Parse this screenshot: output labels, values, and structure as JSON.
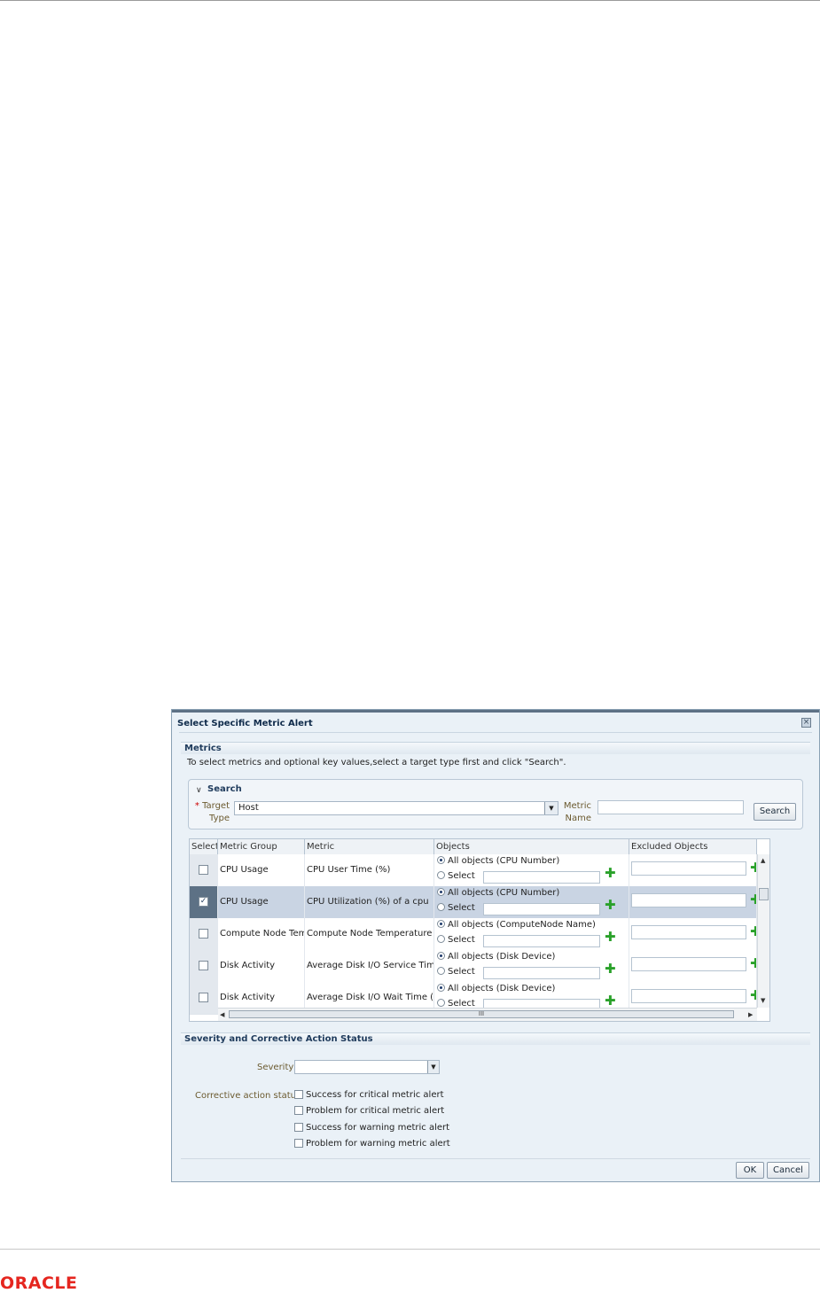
{
  "dialog": {
    "title": "Select Specific Metric Alert",
    "close_glyph": "×",
    "metrics_header": "Metrics",
    "instructions": "To select metrics and optional key values,select a target type first and click \"Search\".",
    "search": {
      "title": "Search",
      "target_type_label": "Target Type",
      "target_type_label_line1": "Target",
      "target_type_label_line2": "Type",
      "target_type_value": "Host",
      "metric_name_label_line1": "Metric",
      "metric_name_label_line2": "Name",
      "metric_name_value": "",
      "search_button": "Search"
    },
    "grid": {
      "columns": [
        "Select",
        "Metric Group",
        "Metric",
        "Objects",
        "Excluded Objects"
      ],
      "rows": [
        {
          "selected": false,
          "metric_group": "CPU Usage",
          "metric": "CPU User Time (%)",
          "all_objects": "All objects (CPU Number)",
          "select_label": "Select"
        },
        {
          "selected": true,
          "metric_group": "CPU Usage",
          "metric": "CPU Utilization (%) of a cpu",
          "all_objects": "All objects (CPU Number)",
          "select_label": "Select"
        },
        {
          "selected": false,
          "metric_group": "Compute Node Tempe",
          "metric": "Compute Node Temperature",
          "all_objects": "All objects (ComputeNode Name)",
          "select_label": "Select"
        },
        {
          "selected": false,
          "metric_group": "Disk Activity",
          "metric": "Average Disk I/O Service Time (",
          "all_objects": "All objects (Disk Device)",
          "select_label": "Select"
        },
        {
          "selected": false,
          "metric_group": "Disk Activity",
          "metric": "Average Disk I/O Wait Time (ms",
          "all_objects": "All objects (Disk Device)",
          "select_label": "Select"
        }
      ],
      "hscroll_grip": "III"
    },
    "severity_section": {
      "header": "Severity and Corrective Action Status",
      "severity_label": "Severity",
      "severity_value": "",
      "corrective_label": "Corrective action status",
      "options": [
        "Success for critical metric alert",
        "Problem for critical metric alert",
        "Success for warning metric alert",
        "Problem for warning metric alert"
      ]
    },
    "ok_button": "OK",
    "cancel_button": "Cancel"
  },
  "footer": {
    "logo_text": "ORACLE",
    "logo_color": "#e5261f"
  },
  "colors": {
    "dialog_bg": "#eaf1f7",
    "selected_row": "#c9d4e3",
    "label_text": "#6b5a2f",
    "plus_icon": "#2aa12a"
  }
}
